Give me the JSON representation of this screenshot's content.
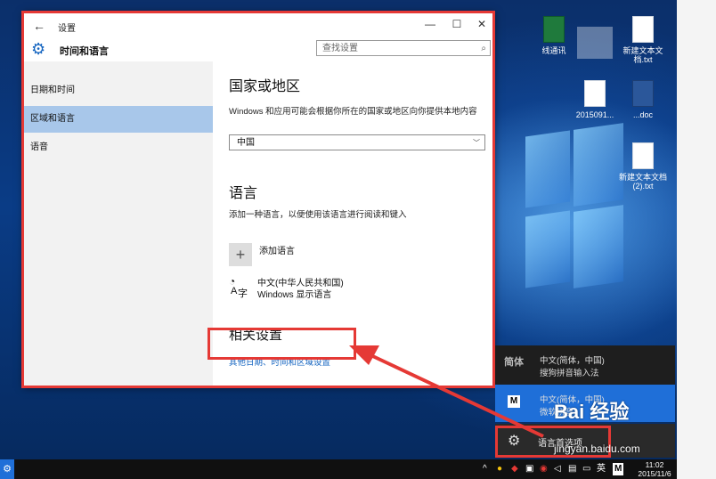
{
  "window": {
    "title": "设置",
    "back_glyph": "←",
    "min_glyph": "—",
    "max_glyph": "☐",
    "close_glyph": "✕"
  },
  "header": {
    "title": "时间和语言",
    "search_placeholder": "查找设置"
  },
  "sidebar": {
    "items": [
      {
        "label": "日期和时间",
        "selected": false
      },
      {
        "label": "区域和语言",
        "selected": true
      },
      {
        "label": "语音",
        "selected": false
      }
    ]
  },
  "region": {
    "heading": "国家或地区",
    "description": "Windows 和应用可能会根据你所在的国家或地区向你提供本地内容",
    "country_value": "中国"
  },
  "language": {
    "heading": "语言",
    "description": "添加一种语言，以便使用该语言进行阅读和键入",
    "add_label": "添加语言",
    "installed_name": "中文(中华人民共和国)",
    "installed_sub": "Windows 显示语言"
  },
  "related": {
    "heading": "相关设置",
    "link": "其他日期、时间和区域设置"
  },
  "flyout": {
    "items": [
      {
        "abbr": "简体",
        "line1": "中文(简体，中国)",
        "line2": "搜狗拼音输入法",
        "selected": false
      },
      {
        "abbr": "M",
        "line1": "中文(简体，中国)",
        "line2": "微软拼音",
        "selected": true
      }
    ],
    "preferences_label": "语言首选项"
  },
  "desktop_icons": [
    {
      "label": "线通讯"
    },
    {
      "label": "新建文本文档.txt"
    },
    {
      "label": "2015091..."
    },
    {
      "label": "...doc"
    },
    {
      "label": "新建文本文档 (2).txt"
    }
  ],
  "taskbar": {
    "time": "11:02",
    "date": "2015/11/6",
    "ime_label": "英",
    "ime_m": "M"
  },
  "watermark": {
    "brand": "Bai 经验",
    "url": "jingyan.baidu.com"
  },
  "colors": {
    "accent": "#1565c0",
    "selection": "#a8c7ea",
    "annotation_red": "#e53935",
    "flyout_selected": "#1f6fd8"
  }
}
